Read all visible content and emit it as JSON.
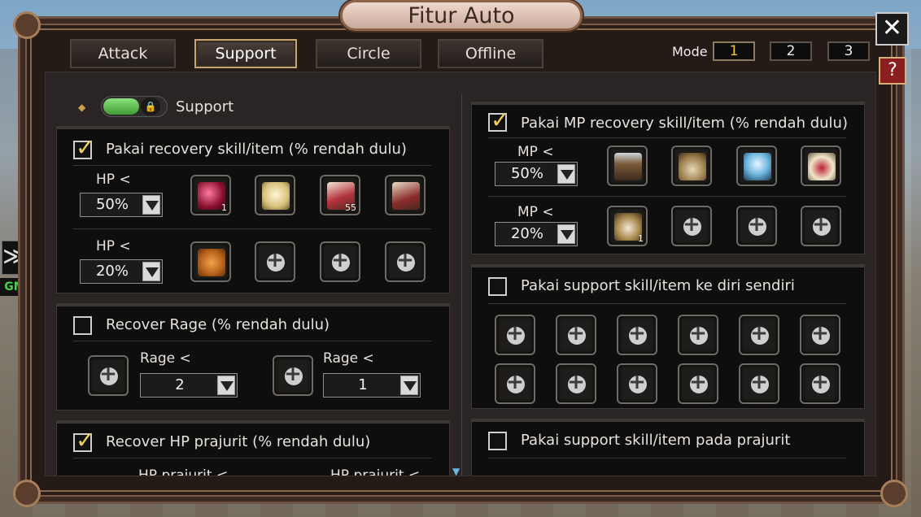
{
  "window": {
    "title": "Fitur Auto",
    "close_label": "✕",
    "help_label": "?"
  },
  "tabs": [
    {
      "label": "Attack"
    },
    {
      "label": "Support"
    },
    {
      "label": "Circle"
    },
    {
      "label": "Offline"
    }
  ],
  "mode": {
    "label": "Mode",
    "options": [
      "1",
      "2",
      "3"
    ],
    "selected": "1"
  },
  "side": {
    "arrow": "≫",
    "gm": "GM"
  },
  "support_toggle": {
    "label": "Support",
    "state": "on"
  },
  "hp_panel": {
    "title": "Pakai recovery skill/item (% rendah dulu)",
    "checked": true,
    "row1": {
      "label": "HP  <",
      "value": "50%",
      "counts": [
        "1",
        "",
        "55",
        ""
      ]
    },
    "row2": {
      "label": "HP  <",
      "value": "20%"
    }
  },
  "rage_panel": {
    "title": "Recover Rage (% rendah dulu)",
    "checked": false,
    "left": {
      "label": "Rage <",
      "value": "2"
    },
    "right": {
      "label": "Rage <",
      "value": "1"
    }
  },
  "soldier_panel": {
    "title": "Recover HP prajurit (% rendah dulu)",
    "checked": true,
    "left_label": "HP prajurit <",
    "right_label": "HP prajurit <"
  },
  "mp_panel": {
    "title": "Pakai MP recovery skill/item (% rendah dulu)",
    "checked": true,
    "row1": {
      "label": "MP  <",
      "value": "50%"
    },
    "row2": {
      "label": "MP  <",
      "value": "20%",
      "count": "1"
    }
  },
  "self_support_panel": {
    "title": "Pakai support skill/item ke diri sendiri",
    "checked": false
  },
  "soldier_support_panel": {
    "title": "Pakai support skill/item pada prajurit",
    "checked": false
  }
}
